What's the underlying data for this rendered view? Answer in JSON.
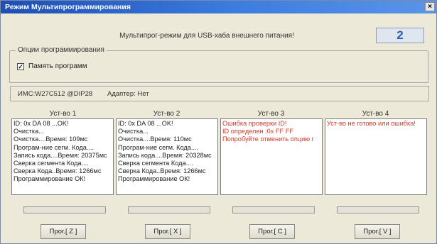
{
  "window": {
    "title": "Режим Мультипрограммирования",
    "close_label": "×"
  },
  "header": {
    "text": "Мультипрог-режим для USB-хаба внешнего питания!",
    "counter": "2"
  },
  "options": {
    "legend": "Опции программирования",
    "checkbox_label": "Память программ",
    "checkbox_mark": "✓",
    "checked": true
  },
  "chip": {
    "ic_text": "ИМС:W27C512 @DIP28",
    "adapter_text": "Адаптер: Нет"
  },
  "devices": [
    {
      "label": "Уст-во 1",
      "lines": [
        "ID: 0x DA 08 ...OK!",
        "Очистка...",
        "Очистка....Время: 109мс",
        "Програм-ние сегм. Кода....",
        "Запись кода....Время: 20375мс",
        "Сверка сегмента Кода....",
        "Сверка Кода..Время: 1266мс",
        "Программирование ОК!"
      ],
      "error": false,
      "progress": 0,
      "button": "Прог.[ Z ]"
    },
    {
      "label": "Уст-во 2",
      "lines": [
        "ID: 0x DA 08 ...OK!",
        "Очистка...",
        "Очистка....Время: 110мс",
        "Програм-ние сегм. Кода....",
        "Запись кода....Время: 20328мс",
        "Сверка сегмента Кода....",
        "Сверка Кода..Время: 1266мс",
        "Программирование ОК!"
      ],
      "error": false,
      "progress": 0,
      "button": "Прог.[ X ]"
    },
    {
      "label": "Уст-во 3",
      "lines": [
        "Ошибка проверки ID!",
        "ID определен :0x FF FF",
        "Попробуйте отменить опцию г"
      ],
      "error": true,
      "progress": 0,
      "button": "Прог.[ C ]"
    },
    {
      "label": "Уст-во 4",
      "lines": [
        "Уст-во не готово или ошибка!"
      ],
      "error": true,
      "progress": 0,
      "button": "Прог.[ V ]"
    }
  ],
  "colors": {
    "title_bar": "#1d4fb5",
    "counter": "#2a5db8",
    "error_text": "#d03a2a"
  }
}
